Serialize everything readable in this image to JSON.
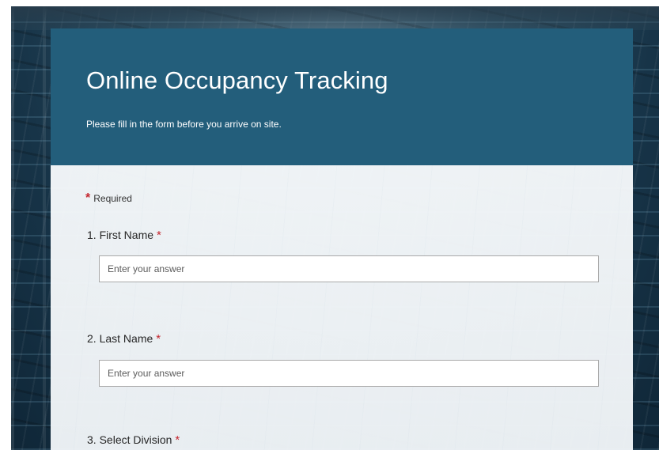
{
  "form": {
    "title": "Online Occupancy Tracking",
    "description": "Please fill in the form before you arrive on site.",
    "required_marker": "*",
    "required_text": "Required"
  },
  "questions": [
    {
      "number": "1.",
      "label": "First Name",
      "required_marker": "*",
      "placeholder": "Enter your answer",
      "value": ""
    },
    {
      "number": "2.",
      "label": "Last Name",
      "required_marker": "*",
      "placeholder": "Enter your answer",
      "value": ""
    },
    {
      "number": "3.",
      "label": "Select Division",
      "required_marker": "*"
    }
  ],
  "colors": {
    "header_bg": "#235e7b",
    "required_asterisk": "#c4262e"
  }
}
